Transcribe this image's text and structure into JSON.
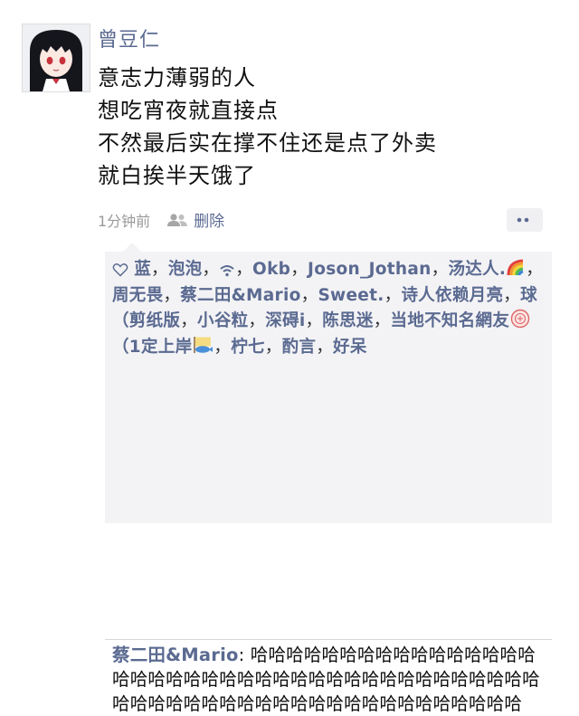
{
  "post": {
    "username": "曾豆仁",
    "lines": [
      "意志力薄弱的人",
      "想吃宵夜就直接点",
      "不然最后实在撑不住还是点了外卖",
      "就白挨半天饿了"
    ],
    "time": "1分钟前",
    "delete_label": "删除"
  },
  "likes": {
    "icon": "heart-outline-icon",
    "names": [
      "蓝",
      "泡泡",
      "",
      "Okb",
      "Joson_Jothan",
      "汤达人.",
      "周无畏",
      "蔡二田&Mario",
      "Sweet.",
      "诗人依赖月亮",
      "球（剪纸版",
      "小谷粒",
      "深碍i",
      "陈思迷",
      "当地不知名網友",
      "（1定上岸",
      "柠七",
      "酌言",
      "好呆"
    ],
    "separator": "，"
  },
  "comment": {
    "author": "蔡二田&Mario",
    "colon": ": ",
    "text": "哈哈哈哈哈哈哈哈哈哈哈哈哈哈哈哈哈哈哈哈哈哈哈哈哈哈哈哈哈哈哈哈哈哈哈哈哈哈哈哈哈哈哈哈哈哈哈哈哈哈哈哈哈哈哈哈哈哈哈哈哈哈哈"
  },
  "colors": {
    "link": "#5b6a91",
    "muted": "#9a9a9a",
    "panel": "#f3f3f5"
  }
}
